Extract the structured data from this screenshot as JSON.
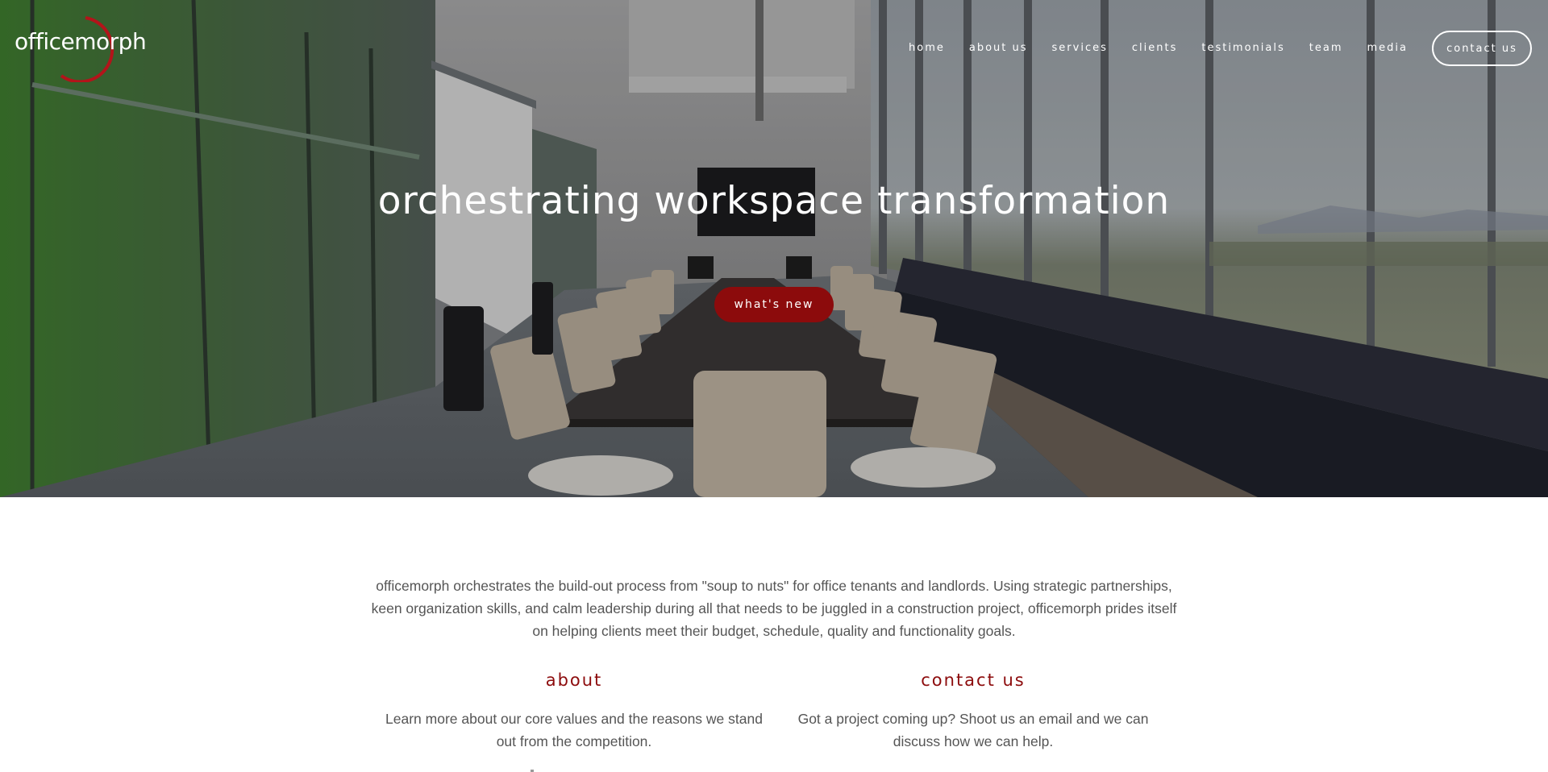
{
  "brand": {
    "name": "officemorph",
    "accent_color": "#8c0b0c"
  },
  "nav": {
    "items": [
      {
        "label": "home"
      },
      {
        "label": "about us"
      },
      {
        "label": "services"
      },
      {
        "label": "clients"
      },
      {
        "label": "testimonials"
      },
      {
        "label": "team"
      },
      {
        "label": "media"
      }
    ],
    "cta_label": "contact us"
  },
  "hero": {
    "title": "orchestrating workspace transformation",
    "button_label": "what's new"
  },
  "intro": {
    "text": "officemorph orchestrates the build-out process from \"soup to nuts\" for office tenants and landlords.  Using strategic partnerships, keen organization skills, and calm leadership during all that needs to be juggled in a construction project, officemorph prides itself on helping clients meet their budget, schedule, quality and functionality goals."
  },
  "columns": [
    {
      "heading": "about",
      "text": "Learn more about our core values and the reasons we stand out from the competition."
    },
    {
      "heading": "contact us",
      "text": "Got a project coming up? Shoot us an email and we can discuss how we can help."
    }
  ]
}
